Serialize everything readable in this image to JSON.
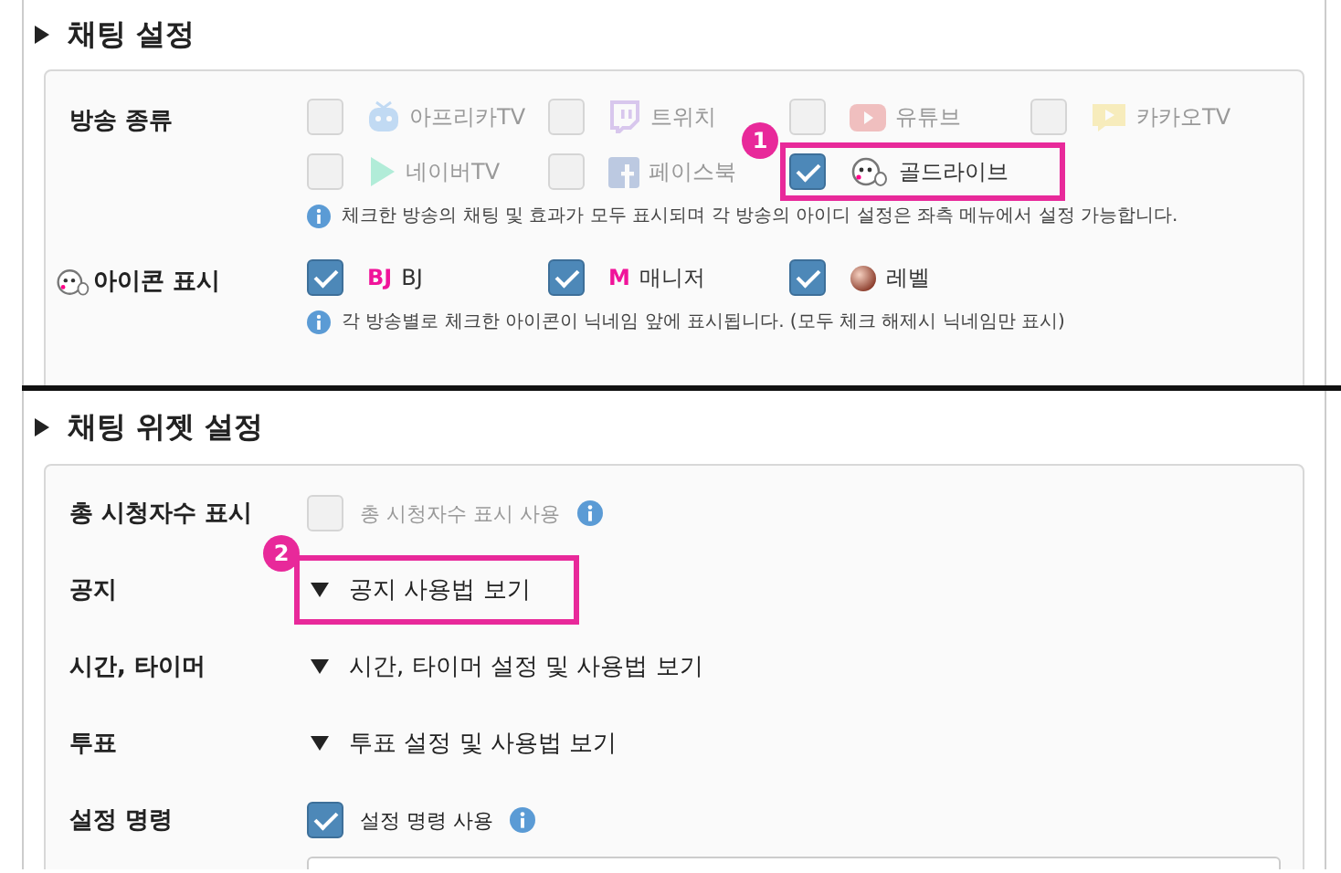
{
  "chat_settings": {
    "title": "채팅 설정",
    "platform_row": {
      "label": "방송 종류",
      "options": [
        {
          "name": "아프리카TV",
          "checked": false,
          "disabled": true
        },
        {
          "name": "트위치",
          "checked": false,
          "disabled": true
        },
        {
          "name": "유튜브",
          "checked": false,
          "disabled": true
        },
        {
          "name": "카카오TV",
          "checked": false,
          "disabled": true
        },
        {
          "name": "네이버TV",
          "checked": false,
          "disabled": true
        },
        {
          "name": "페이스북",
          "checked": false,
          "disabled": true
        },
        {
          "name": "골드라이브",
          "checked": true,
          "disabled": false,
          "callout": "1"
        }
      ],
      "note": "체크한 방송의 채팅 및 효과가 모두 표시되며 각 방송의 아이디 설정은 좌측 메뉴에서 설정 가능합니다."
    },
    "icon_row": {
      "label": "아이콘 표시",
      "options": [
        {
          "badge": "BJ",
          "name": "BJ",
          "checked": true
        },
        {
          "badge": "M",
          "name": "매니저",
          "checked": true
        },
        {
          "name": "레벨",
          "checked": true
        }
      ],
      "note": "각 방송별로 체크한 아이콘이 닉네임 앞에 표시됩니다. (모두 체크 해제시 닉네임만 표시)"
    }
  },
  "widget_settings": {
    "title": "채팅 위젯 설정",
    "rows": [
      {
        "kind": "checkbox",
        "label": "총 시청자수 표시",
        "text": "총 시청자수 표시 사용",
        "checked": false,
        "disabled": true
      },
      {
        "kind": "expander",
        "label": "공지",
        "text": "공지 사용법 보기",
        "callout": "2"
      },
      {
        "kind": "expander",
        "label": "시간, 타이머",
        "text": "시간, 타이머 설정 및 사용법 보기"
      },
      {
        "kind": "expander",
        "label": "투표",
        "text": "투표 설정 및 사용법 보기"
      },
      {
        "kind": "checkbox",
        "label": "설정 명령",
        "text": "설정 명령 사용",
        "checked": true,
        "disabled": false,
        "field": true
      }
    ]
  }
}
